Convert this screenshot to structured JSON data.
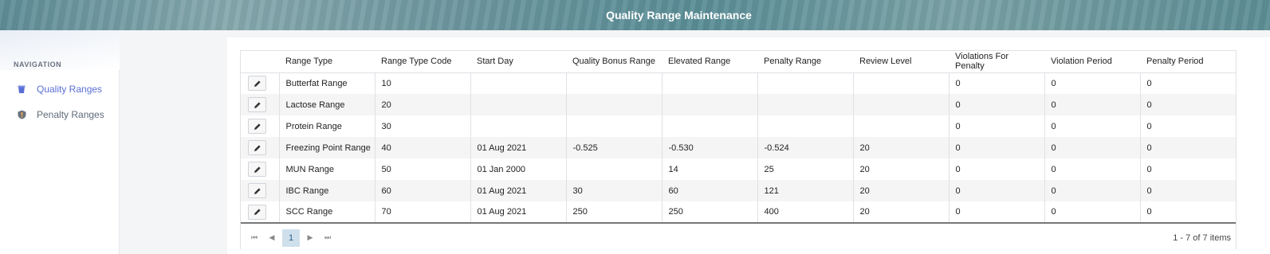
{
  "header": {
    "title": "Quality Range Maintenance"
  },
  "sidebar": {
    "heading": "NAVIGATION",
    "items": [
      {
        "label": "Quality Ranges",
        "icon": "bucket-icon",
        "active": true
      },
      {
        "label": "Penalty Ranges",
        "icon": "shield-icon",
        "active": false
      }
    ]
  },
  "grid": {
    "columns": [
      "",
      "Range Type",
      "Range Type Code",
      "Start Day",
      "Quality Bonus Range",
      "Elevated Range",
      "Penalty Range",
      "Review Level",
      "Violations For Penalty",
      "Violation Period",
      "Penalty Period"
    ],
    "rows": [
      [
        "Butterfat Range",
        "10",
        "",
        "",
        "",
        "",
        "",
        "0",
        "0",
        "0"
      ],
      [
        "Lactose Range",
        "20",
        "",
        "",
        "",
        "",
        "",
        "0",
        "0",
        "0"
      ],
      [
        "Protein Range",
        "30",
        "",
        "",
        "",
        "",
        "",
        "0",
        "0",
        "0"
      ],
      [
        "Freezing Point Range",
        "40",
        "01 Aug 2021",
        "-0.525",
        "-0.530",
        "-0.524",
        "20",
        "0",
        "0",
        "0"
      ],
      [
        "MUN Range",
        "50",
        "01 Jan 2000",
        "",
        "14",
        "25",
        "20",
        "0",
        "0",
        "0"
      ],
      [
        "IBC Range",
        "60",
        "01 Aug 2021",
        "30",
        "60",
        "121",
        "20",
        "0",
        "0",
        "0"
      ],
      [
        "SCC Range",
        "70",
        "01 Aug 2021",
        "250",
        "250",
        "400",
        "20",
        "0",
        "0",
        "0"
      ]
    ]
  },
  "pager": {
    "first": "⏮",
    "prev": "◀",
    "current": "1",
    "next": "▶",
    "last": "⏭",
    "info": "1 - 7 of 7 items"
  },
  "colors": {
    "accent": "#5a6fd6",
    "header": "#6e979f"
  }
}
